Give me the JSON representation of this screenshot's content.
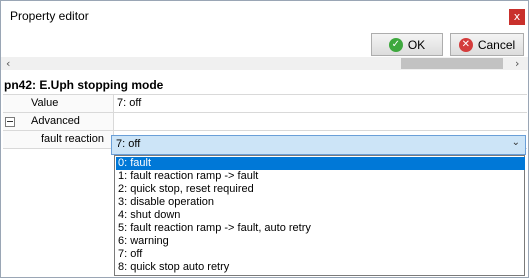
{
  "window": {
    "title": "Property editor",
    "close_glyph": "x"
  },
  "toolbar": {
    "ok_label": "OK",
    "cancel_label": "Cancel",
    "ok_icon": "check-icon",
    "cancel_icon": "cancel-icon"
  },
  "parameter": {
    "title": "pn42: E.Uph stopping mode"
  },
  "grid": {
    "rows": [
      {
        "label": "Value",
        "value": "7: off"
      },
      {
        "label": "Advanced",
        "value": ""
      },
      {
        "label": "fault reaction",
        "value": "7: off"
      }
    ]
  },
  "dropdown": {
    "selected_index": 0,
    "options": [
      "0: fault",
      "1: fault reaction ramp -> fault",
      "2: quick stop, reset required",
      "3: disable operation",
      "4: shut down",
      "5: fault reaction ramp -> fault, auto retry",
      "6: warning",
      "7: off",
      "8: quick stop auto retry"
    ]
  },
  "colors": {
    "selection": "#0078d7",
    "combo_bg": "#cce4f7",
    "ok_icon": "#3ea83e",
    "cancel_icon": "#d43c3c",
    "close_bg": "#c9302c"
  }
}
